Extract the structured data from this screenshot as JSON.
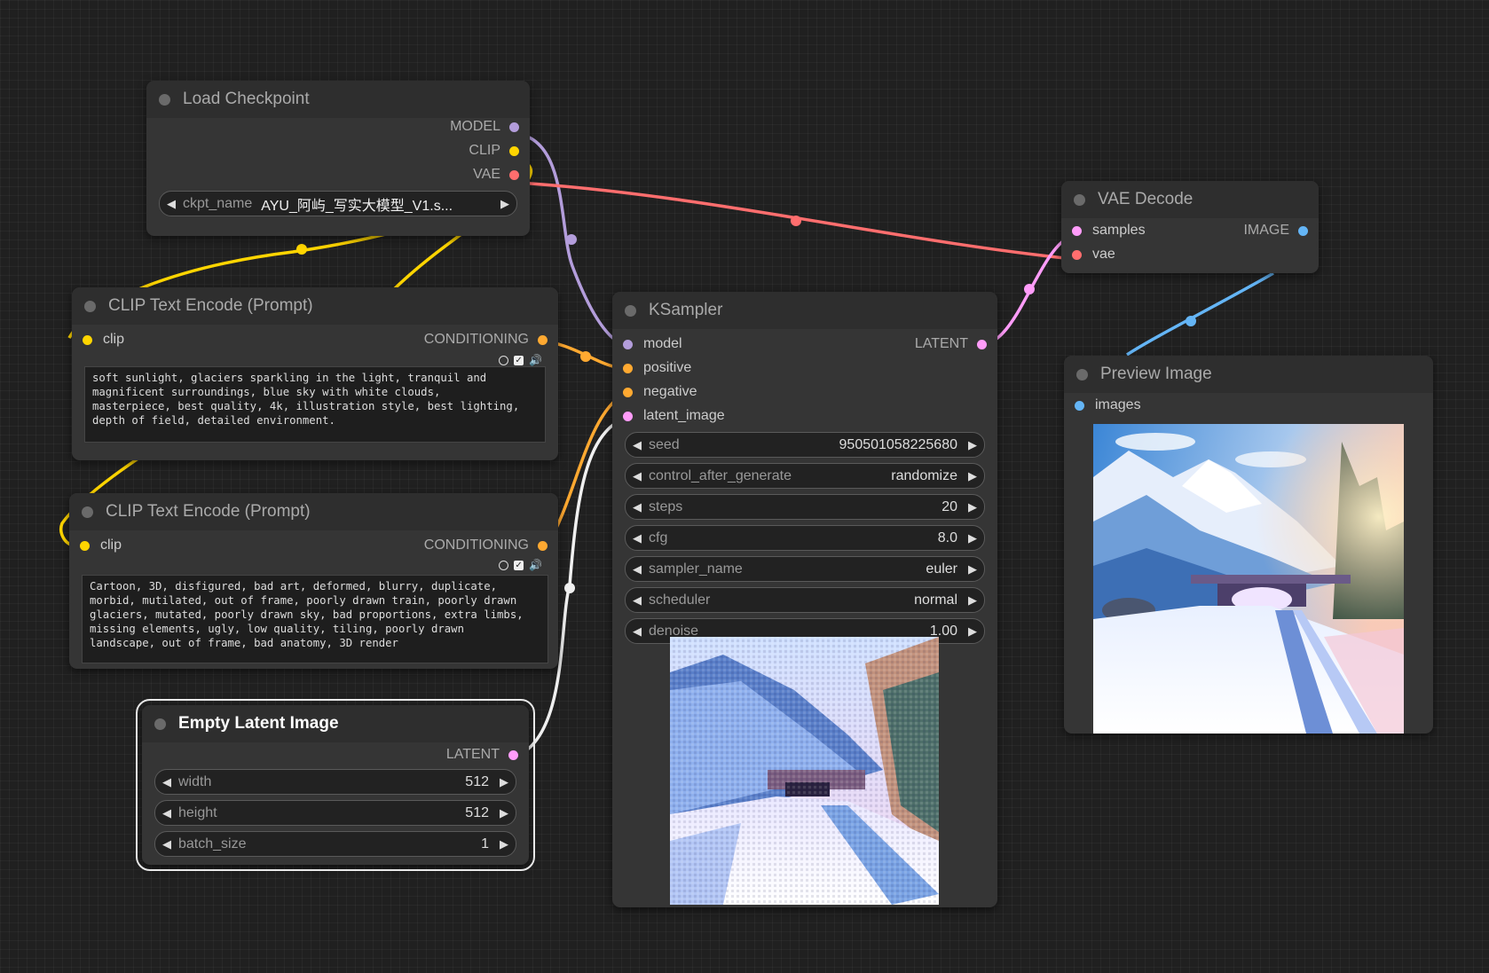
{
  "colors": {
    "model": "#b39ddb",
    "clip": "#ffd500",
    "vae": "#ff6e6e",
    "conditioning": "#ffa931",
    "latent": "#ff9cf9",
    "image": "#64b5f6"
  },
  "load_checkpoint": {
    "title": "Load Checkpoint",
    "outputs": [
      "MODEL",
      "CLIP",
      "VAE"
    ],
    "ckpt_label": "ckpt_name",
    "ckpt_value": "AYU_阿屿_写实大模型_V1.s..."
  },
  "clip_positive": {
    "title": "CLIP Text Encode (Prompt)",
    "input": "clip",
    "output": "CONDITIONING",
    "text": "soft sunlight, glaciers sparkling in the light, tranquil and\nmagnificent surroundings, blue sky with white clouds,\nmasterpiece, best quality, 4k, illustration style, best lighting,\ndepth of field, detailed environment."
  },
  "clip_negative": {
    "title": "CLIP Text Encode (Prompt)",
    "input": "clip",
    "output": "CONDITIONING",
    "text": "Cartoon, 3D, disfigured, bad art, deformed, blurry, duplicate,\nmorbid, mutilated, out of frame, poorly drawn train, poorly drawn\nglaciers, mutated, poorly drawn sky, bad proportions, extra limbs,\nmissing elements, ugly, low quality, tiling, poorly drawn\nlandscape, out of frame, bad anatomy, 3D render"
  },
  "empty_latent": {
    "title": "Empty Latent Image",
    "output": "LATENT",
    "widgets": [
      {
        "label": "width",
        "value": "512"
      },
      {
        "label": "height",
        "value": "512"
      },
      {
        "label": "batch_size",
        "value": "1"
      }
    ]
  },
  "ksampler": {
    "title": "KSampler",
    "inputs": [
      "model",
      "positive",
      "negative",
      "latent_image"
    ],
    "output": "LATENT",
    "widgets": [
      {
        "label": "seed",
        "value": "950501058225680"
      },
      {
        "label": "control_after_generate",
        "value": "randomize"
      },
      {
        "label": "steps",
        "value": "20"
      },
      {
        "label": "cfg",
        "value": "8.0"
      },
      {
        "label": "sampler_name",
        "value": "euler"
      },
      {
        "label": "scheduler",
        "value": "normal"
      },
      {
        "label": "denoise",
        "value": "1.00"
      }
    ]
  },
  "vae_decode": {
    "title": "VAE Decode",
    "inputs": [
      "samples",
      "vae"
    ],
    "output": "IMAGE"
  },
  "preview_image": {
    "title": "Preview Image",
    "input": "images"
  },
  "icons": {
    "node_dot": "status-dot",
    "arrow_left": "◀",
    "arrow_right": "▶"
  }
}
